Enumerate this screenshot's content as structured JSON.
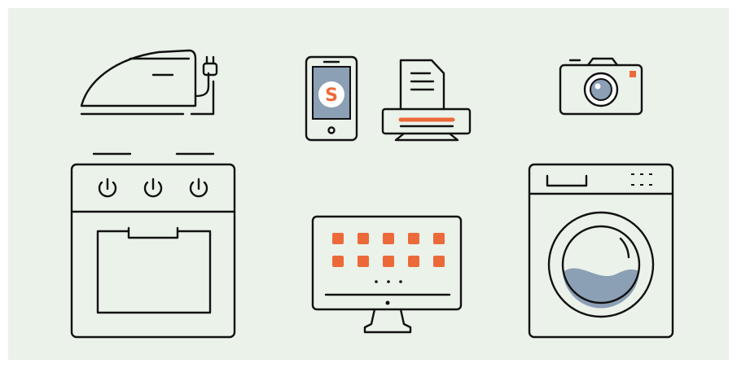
{
  "colors": {
    "background": "#ebf2ea",
    "line": "#111111",
    "accent": "#ec6a3a",
    "screen": "#8b9fb5",
    "water": "#8b9fb5"
  },
  "icons": [
    "iron-icon",
    "smartphone-icon",
    "printer-icon",
    "camera-icon",
    "oven-icon",
    "monitor-icon",
    "washing-machine-icon"
  ],
  "smartphone": {
    "logo_letter": "S"
  },
  "monitor": {
    "app_tile_rows": 2,
    "app_tile_columns": 5
  }
}
